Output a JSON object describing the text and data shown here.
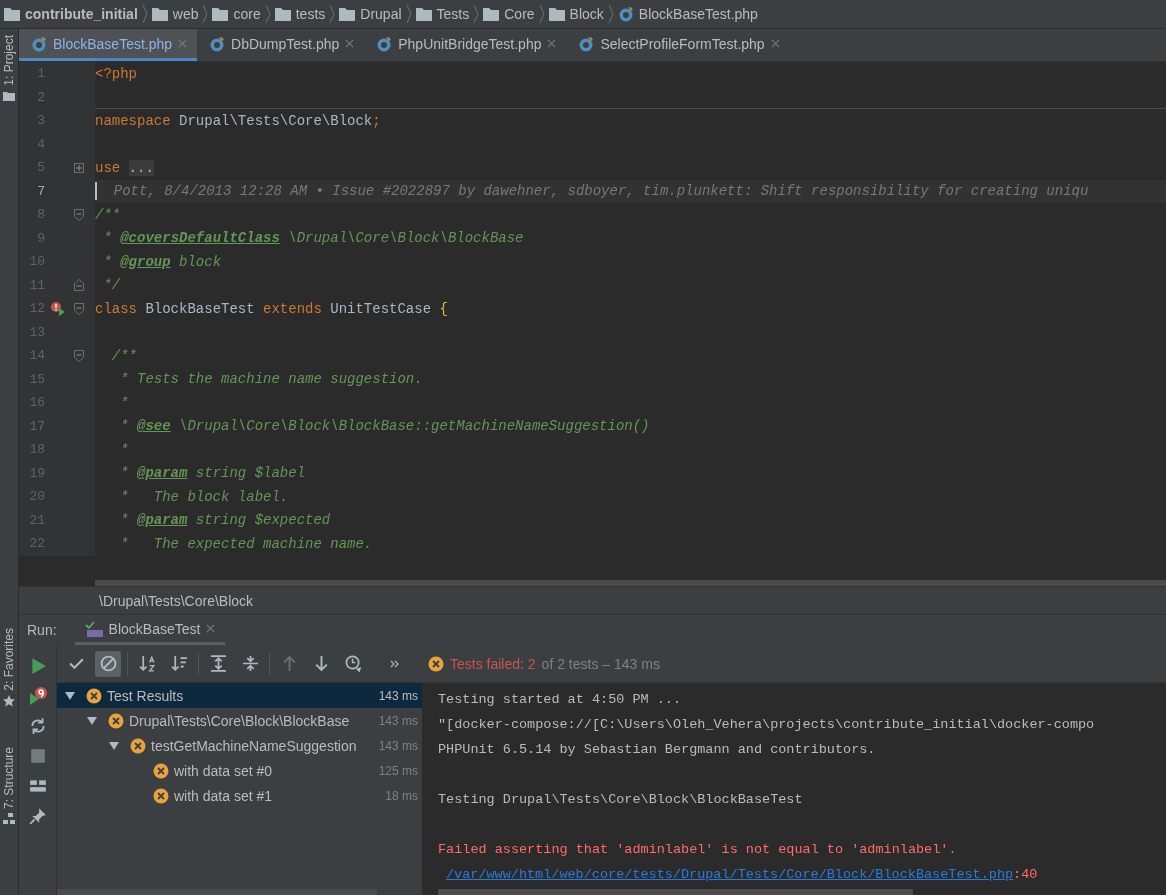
{
  "breadcrumb": [
    {
      "kind": "project",
      "label": "contribute_initial"
    },
    {
      "kind": "folder",
      "label": "web"
    },
    {
      "kind": "folder",
      "label": "core"
    },
    {
      "kind": "folder",
      "label": "tests"
    },
    {
      "kind": "folder",
      "label": "Drupal"
    },
    {
      "kind": "folder",
      "label": "Tests"
    },
    {
      "kind": "folder",
      "label": "Core"
    },
    {
      "kind": "folder",
      "label": "Block"
    },
    {
      "kind": "file",
      "label": "BlockBaseTest.php"
    }
  ],
  "side_tools": [
    {
      "label": "1: Project",
      "kind": "project"
    },
    {
      "label": "2: Favorites",
      "kind": "favorites"
    },
    {
      "label": "7: Structure",
      "kind": "structure"
    }
  ],
  "tabs": [
    {
      "label": "BlockBaseTest.php",
      "selected": true
    },
    {
      "label": "DbDumpTest.php",
      "selected": false
    },
    {
      "label": "PhpUnitBridgeTest.php",
      "selected": false
    },
    {
      "label": "SelectProfileFormTest.php",
      "selected": false
    }
  ],
  "editor": {
    "lines": [
      {
        "number": "1",
        "kind": "code",
        "tokens": [
          {
            "kind": "keyword",
            "text": "<?php"
          }
        ]
      },
      {
        "number": "2",
        "kind": "divider"
      },
      {
        "number": "3",
        "kind": "code",
        "tokens": [
          {
            "kind": "keyword",
            "text": "namespace"
          },
          {
            "kind": "text",
            "text": " Drupal\\Tests\\Core\\Block"
          },
          {
            "kind": "keyword",
            "text": ";"
          }
        ]
      },
      {
        "number": "4",
        "kind": "code"
      },
      {
        "number": "5",
        "kind": "code",
        "fold": {
          "kind": "expand"
        },
        "tokens": [
          {
            "kind": "keyword",
            "text": "use "
          },
          {
            "kind": "folded",
            "text": "..."
          }
        ]
      },
      {
        "number": "7",
        "kind": "annotation",
        "tokens": [
          {
            "kind": "note",
            "text": "  Pott, 8/4/2013 12:28 AM • Issue #2022897 by dawehner, sdboyer, tim.plunkett: Shift responsibility for creating uniqu"
          }
        ]
      },
      {
        "number": "8",
        "kind": "code",
        "fold": {
          "kind": "start"
        },
        "tokens": [
          {
            "kind": "doc",
            "text": "/**"
          }
        ]
      },
      {
        "number": "9",
        "kind": "code",
        "tokens": [
          {
            "kind": "doc",
            "text": " * "
          },
          {
            "kind": "doctag",
            "text": "@coversDefaultClass"
          },
          {
            "kind": "doc",
            "text": " \\Drupal\\Core\\Block\\BlockBase"
          }
        ]
      },
      {
        "number": "10",
        "kind": "code",
        "tokens": [
          {
            "kind": "doc",
            "text": " * "
          },
          {
            "kind": "doctag",
            "text": "@group"
          },
          {
            "kind": "doc",
            "text": " block"
          }
        ]
      },
      {
        "number": "11",
        "kind": "code",
        "fold": {
          "kind": "end"
        },
        "tokens": [
          {
            "kind": "doc",
            "text": " */"
          }
        ]
      },
      {
        "number": "12",
        "kind": "code",
        "fold": {
          "kind": "start"
        },
        "gutter": {
          "kind": "run-failed"
        },
        "tokens": [
          {
            "kind": "keyword",
            "text": "class"
          },
          {
            "kind": "text",
            "text": " BlockBaseTest "
          },
          {
            "kind": "keyword",
            "text": "extends"
          },
          {
            "kind": "text",
            "text": " UnitTestCase "
          },
          {
            "kind": "brace",
            "text": "{"
          }
        ]
      },
      {
        "number": "13",
        "kind": "code"
      },
      {
        "number": "14",
        "kind": "code",
        "fold": {
          "kind": "start"
        },
        "tokens": [
          {
            "kind": "doc",
            "text": "  /**"
          }
        ]
      },
      {
        "number": "15",
        "kind": "code",
        "tokens": [
          {
            "kind": "doc",
            "text": "   * Tests the machine name suggestion."
          }
        ]
      },
      {
        "number": "16",
        "kind": "code",
        "tokens": [
          {
            "kind": "doc",
            "text": "   *"
          }
        ]
      },
      {
        "number": "17",
        "kind": "code",
        "tokens": [
          {
            "kind": "doc",
            "text": "   * "
          },
          {
            "kind": "doctag",
            "text": "@see"
          },
          {
            "kind": "doc",
            "text": " \\Drupal\\Core\\Block\\BlockBase::getMachineNameSuggestion()"
          }
        ]
      },
      {
        "number": "18",
        "kind": "code",
        "tokens": [
          {
            "kind": "doc",
            "text": "   *"
          }
        ]
      },
      {
        "number": "19",
        "kind": "code",
        "tokens": [
          {
            "kind": "doc",
            "text": "   * "
          },
          {
            "kind": "doctag",
            "text": "@param"
          },
          {
            "kind": "doc",
            "text": " string $label"
          }
        ]
      },
      {
        "number": "20",
        "kind": "code",
        "tokens": [
          {
            "kind": "doc",
            "text": "   *   The block label."
          }
        ]
      },
      {
        "number": "21",
        "kind": "code",
        "tokens": [
          {
            "kind": "doc",
            "text": "   * "
          },
          {
            "kind": "doctag",
            "text": "@param"
          },
          {
            "kind": "doc",
            "text": " string $expected"
          }
        ]
      },
      {
        "number": "22",
        "kind": "code",
        "tokens": [
          {
            "kind": "doc",
            "text": "   *   The expected machine name."
          }
        ]
      }
    ],
    "footer": "\\Drupal\\Tests\\Core\\Block"
  },
  "run": {
    "label": "Run:",
    "tab": "BlockBaseTest",
    "tools": [
      {
        "kind": "rerun",
        "disabled": false
      },
      {
        "kind": "rerun-failed",
        "disabled": false
      },
      {
        "kind": "auto-test",
        "disabled": false
      },
      {
        "kind": "stop",
        "disabled": true
      },
      {
        "kind": "layout",
        "disabled": false
      },
      {
        "kind": "pin",
        "disabled": false
      }
    ],
    "toolbar_groups": [
      [
        {
          "kind": "check",
          "on": false,
          "disabled": false
        },
        {
          "kind": "cancel",
          "on": true,
          "disabled": false
        }
      ],
      [
        {
          "kind": "sort-alpha",
          "on": false,
          "disabled": false
        },
        {
          "kind": "sort-duration",
          "on": false,
          "disabled": false
        }
      ],
      [
        {
          "kind": "expand",
          "on": false,
          "disabled": false
        },
        {
          "kind": "collapse",
          "on": false,
          "disabled": false
        }
      ],
      [
        {
          "kind": "up",
          "on": false,
          "disabled": true
        },
        {
          "kind": "down",
          "on": false,
          "disabled": false
        },
        {
          "kind": "history",
          "on": false,
          "disabled": false
        }
      ]
    ],
    "status": {
      "failed": "Tests failed: 2",
      "rest": "of 2 tests – 143 ms"
    },
    "tree": [
      {
        "label": "Test Results",
        "time": "143 ms",
        "kind": "failed",
        "selected": true,
        "expanded": true,
        "children": [
          {
            "label": "Drupal\\Tests\\Core\\Block\\BlockBase",
            "time": "143 ms",
            "kind": "failed",
            "selected": false,
            "expanded": true,
            "children": [
              {
                "label": "testGetMachineNameSuggestion",
                "time": "143 ms",
                "kind": "failed",
                "selected": false,
                "expanded": true,
                "children": [
                  {
                    "label": "with data set #0",
                    "time": "125 ms",
                    "kind": "failed",
                    "selected": false
                  },
                  {
                    "label": "with data set #1",
                    "time": "18 ms",
                    "kind": "failed",
                    "selected": false
                  }
                ]
              }
            ]
          }
        ]
      }
    ],
    "console": [
      {
        "kind": "plain",
        "text": "Testing started at 4:50 PM ..."
      },
      {
        "kind": "plain",
        "text": "\"[docker-compose://[C:\\Users\\Oleh_Vehera\\projects\\contribute_initial\\docker-compo"
      },
      {
        "kind": "plain",
        "text": "PHPUnit 6.5.14 by Sebastian Bergmann and contributors."
      },
      {
        "kind": "blank"
      },
      {
        "kind": "plain",
        "text": "Testing Drupal\\Tests\\Core\\Block\\BlockBaseTest"
      },
      {
        "kind": "blank"
      },
      {
        "kind": "error",
        "text": "Failed asserting that 'adminlabel' is not equal to 'adminlabel'."
      },
      {
        "kind": "trace",
        "link": "/var/www/html/web/core/tests/Drupal/Tests/Core/Block/BlockBaseTest.php",
        "text": ":40"
      }
    ]
  }
}
